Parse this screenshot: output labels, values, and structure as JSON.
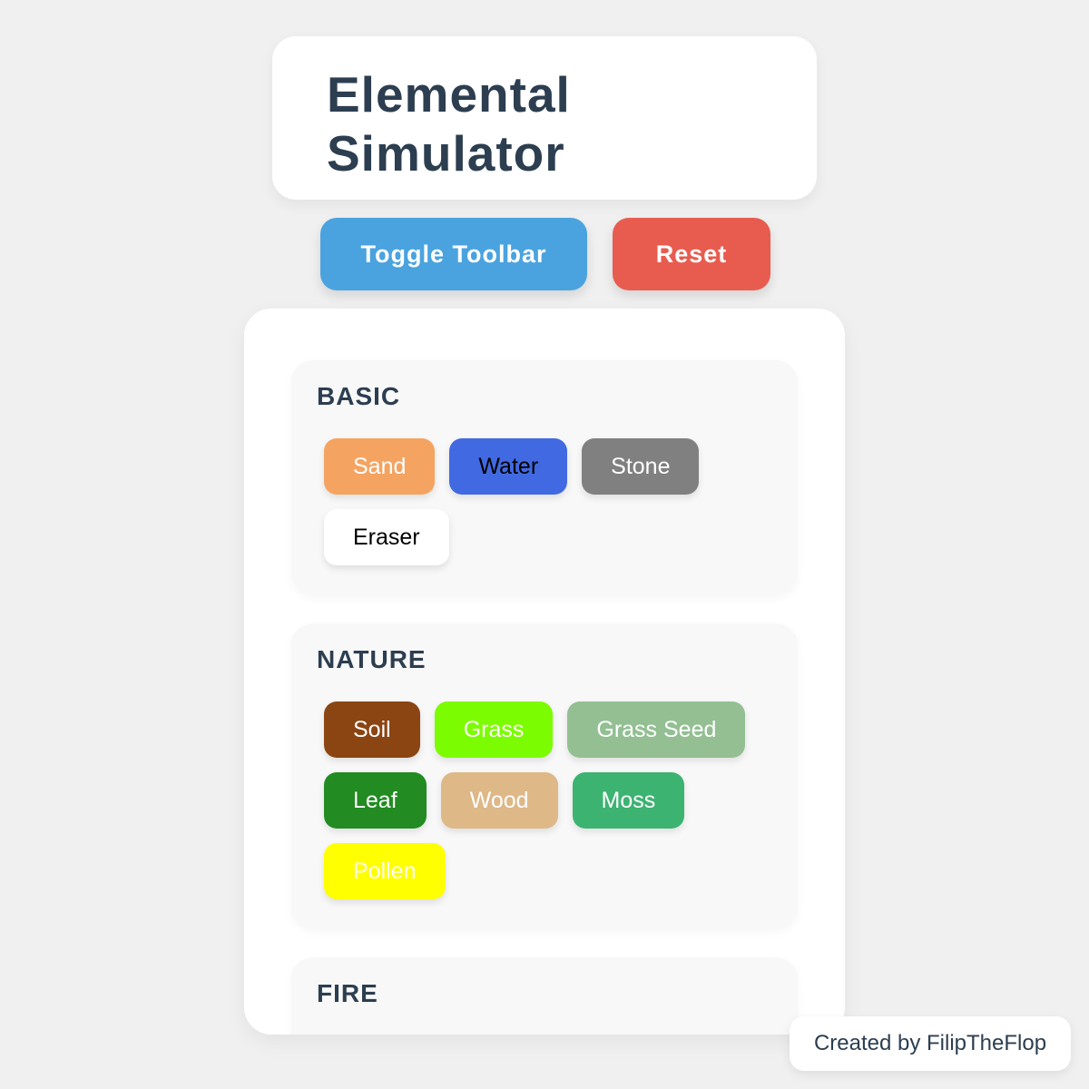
{
  "title": "Elemental Simulator",
  "buttons": {
    "toggle_label": "Toggle Toolbar",
    "reset_label": "Reset"
  },
  "colors": {
    "toggle": "#4aa3df",
    "reset": "#e85c4f",
    "heading": "#2c3e50"
  },
  "sections": [
    {
      "heading": "BASIC",
      "elements": [
        {
          "label": "Sand",
          "bg": "#f4a460",
          "fg": "#ffffff"
        },
        {
          "label": "Water",
          "bg": "#4169e1",
          "fg": "#000000"
        },
        {
          "label": "Stone",
          "bg": "#808080",
          "fg": "#ffffff"
        },
        {
          "label": "Eraser",
          "bg": "#ffffff",
          "fg": "#000000"
        }
      ]
    },
    {
      "heading": "NATURE",
      "elements": [
        {
          "label": "Soil",
          "bg": "#8b4513",
          "fg": "#ffffff"
        },
        {
          "label": "Grass",
          "bg": "#7cfc00",
          "fg": "#ffffff"
        },
        {
          "label": "Grass Seed",
          "bg": "#93bf93",
          "fg": "#ffffff"
        },
        {
          "label": "Leaf",
          "bg": "#228b22",
          "fg": "#ffffff"
        },
        {
          "label": "Wood",
          "bg": "#deb887",
          "fg": "#ffffff"
        },
        {
          "label": "Moss",
          "bg": "#3cb371",
          "fg": "#ffffff"
        },
        {
          "label": "Pollen",
          "bg": "#ffff00",
          "fg": "#ffffff"
        }
      ]
    },
    {
      "heading": "FIRE",
      "elements": []
    }
  ],
  "credit": "Created by FilipTheFlop"
}
